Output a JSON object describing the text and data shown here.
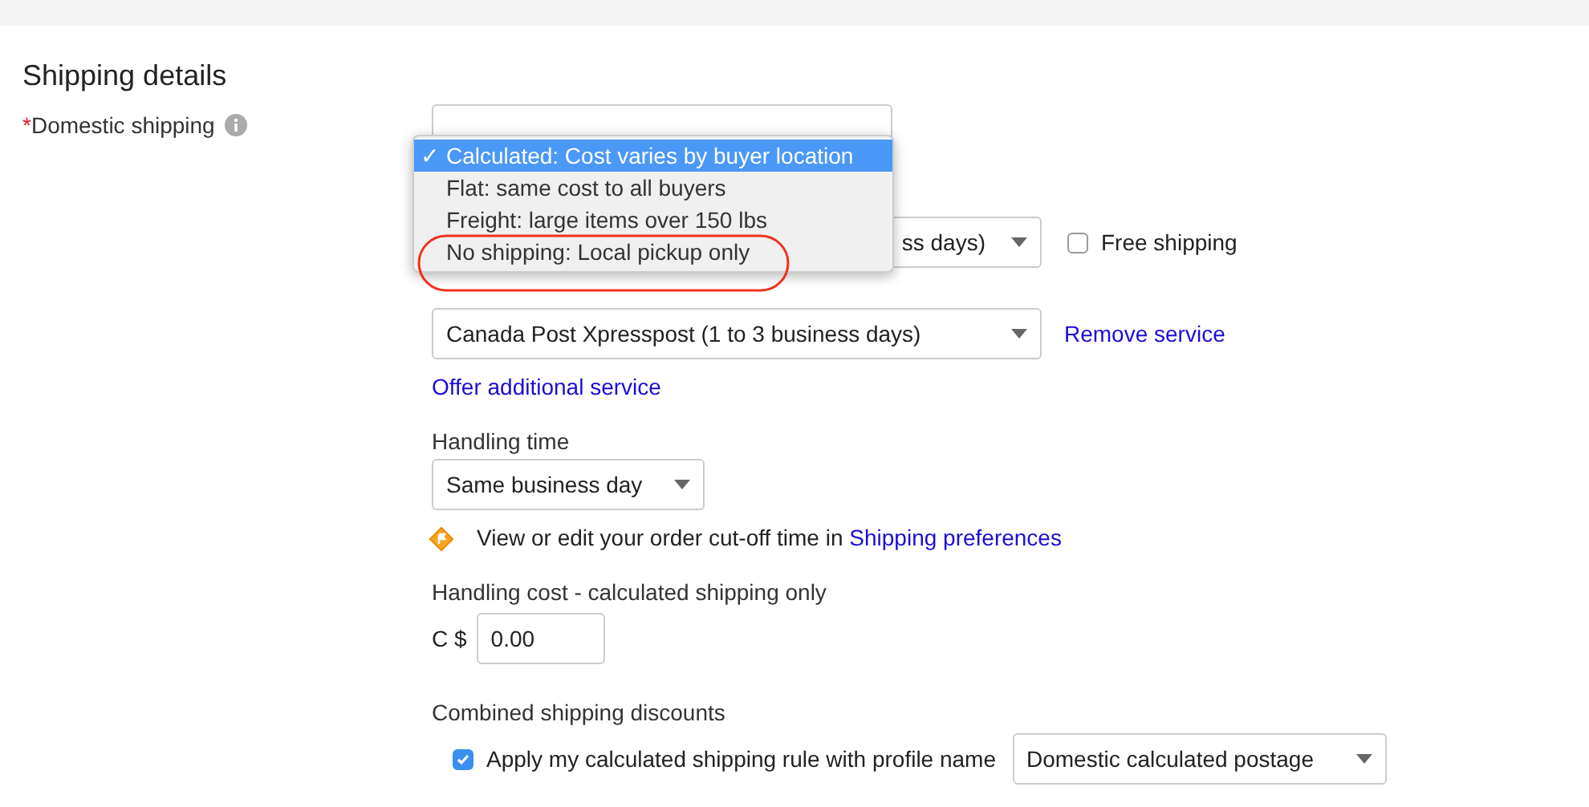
{
  "section_title": "Shipping details",
  "domestic_shipping": {
    "required_mark": "*",
    "label": "Domestic shipping",
    "menu": [
      {
        "label": "Calculated: Cost varies by buyer location",
        "check": "✓",
        "selected": true
      },
      {
        "label": "Flat: same cost to all buyers",
        "selected": false
      },
      {
        "label": "Freight: large items over 150 lbs",
        "selected": false
      },
      {
        "label": "No shipping: Local pickup only",
        "selected": false
      }
    ]
  },
  "services": [
    {
      "value": "ss days)",
      "free_shipping": {
        "label": "Free shipping",
        "checked": false
      }
    },
    {
      "value": "Canada Post Xpresspost (1 to 3 business days)",
      "link": "Remove service"
    }
  ],
  "offer_link": "Offer additional service",
  "handling_time": {
    "label": "Handling time",
    "value": "Same business day"
  },
  "cutoff_note": {
    "text": "View or edit your order cut-off time in",
    "link": "Shipping preferences"
  },
  "handling_cost": {
    "label": "Handling cost - calculated shipping only",
    "currency": "C $",
    "value": "0.00"
  },
  "combined": {
    "label": "Combined shipping discounts",
    "rule_label": "Apply my calculated shipping rule with profile name",
    "checked": true,
    "profile": "Domestic calculated postage"
  }
}
